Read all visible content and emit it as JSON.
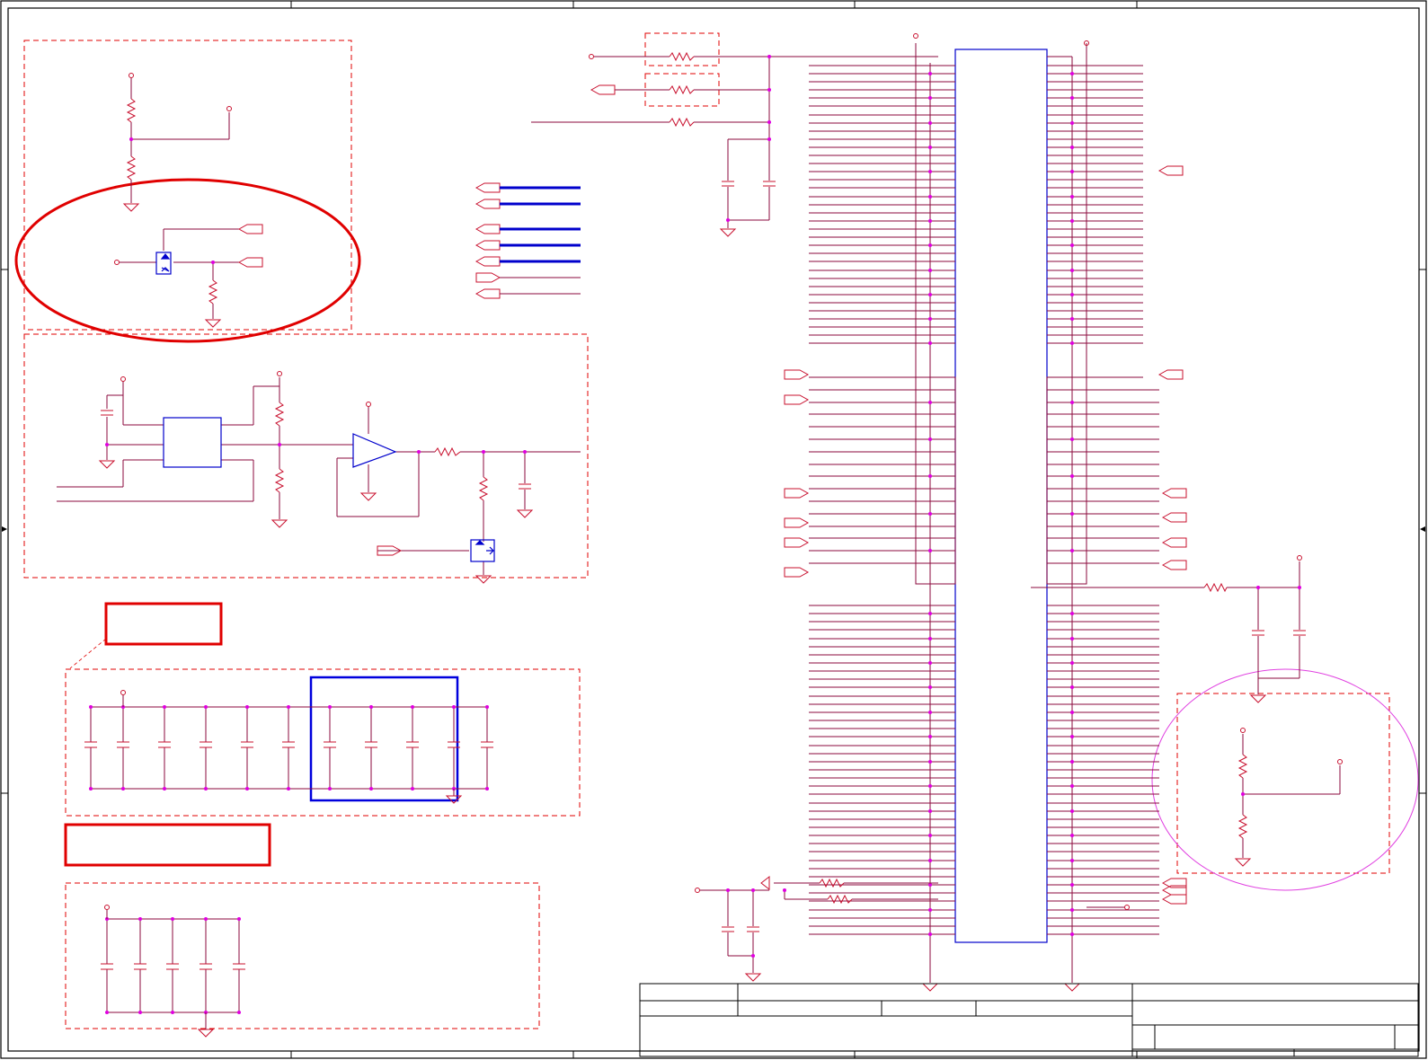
{
  "colors": {
    "wire": "#8B0A3C",
    "component": "#C8102E",
    "pin_blue": "#0000CC",
    "junction": "#E000E0",
    "highlight_red": "#E00000",
    "highlight_magenta": "#E040E0",
    "frame": "#000000",
    "background": "#FFFFFF"
  },
  "sheet": {
    "columns": 5,
    "rows": 4
  },
  "title_block": {
    "title": "",
    "size": "",
    "document_number": "",
    "revision": "",
    "date": "",
    "sheet": ""
  },
  "highlights": {
    "labels": [
      "",
      ""
    ]
  },
  "connector": {
    "pins_left_label": "",
    "pins_right_label": ""
  }
}
